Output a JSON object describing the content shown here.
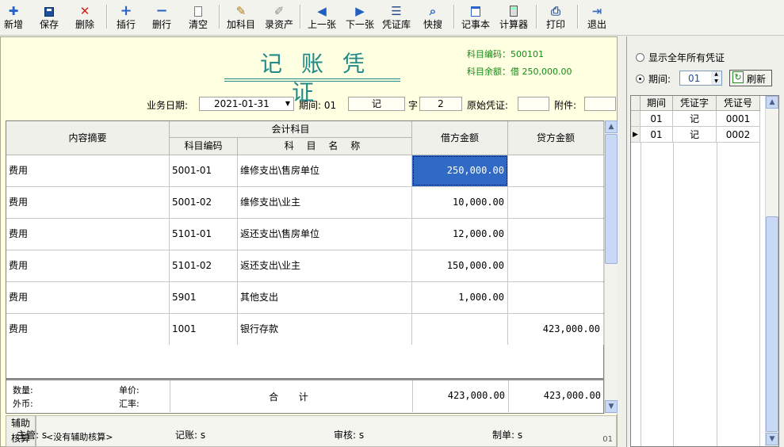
{
  "toolbar": {
    "items": [
      {
        "label": "新增",
        "icon": "add-icon"
      },
      {
        "label": "保存",
        "icon": "save-icon"
      },
      {
        "label": "删除",
        "icon": "delete-icon"
      },
      {
        "label": "插行",
        "icon": "insert-row-icon"
      },
      {
        "label": "删行",
        "icon": "delete-row-icon"
      },
      {
        "label": "清空",
        "icon": "clear-icon"
      },
      {
        "label": "加科目",
        "icon": "add-account-icon"
      },
      {
        "label": "录资产",
        "icon": "record-asset-icon"
      },
      {
        "label": "上一张",
        "icon": "arrow-left-icon"
      },
      {
        "label": "下一张",
        "icon": "arrow-right-icon"
      },
      {
        "label": "凭证库",
        "icon": "voucher-list-icon"
      },
      {
        "label": "快搜",
        "icon": "quick-search-icon"
      },
      {
        "label": "记事本",
        "icon": "notepad-icon"
      },
      {
        "label": "计算器",
        "icon": "calculator-icon"
      },
      {
        "label": "打印",
        "icon": "print-icon"
      },
      {
        "label": "退出",
        "icon": "exit-icon"
      }
    ]
  },
  "voucher": {
    "title": "记账凭证",
    "account_code_label": "科目编码：",
    "account_code": "500101",
    "account_balance_label": "科目余额：",
    "account_balance": "借 250,000.00",
    "business_date_label": "业务日期:",
    "business_date": "2021-01-31",
    "period_label": "期间:",
    "period": "01",
    "voucher_type": "记",
    "voucher_char_label": "字",
    "voucher_number": "2",
    "original_voucher_label": "原始凭证:",
    "original_voucher": "",
    "attachment_label": "附件:",
    "attachment": ""
  },
  "grid": {
    "headers": {
      "summary": "内容摘要",
      "account": "会计科目",
      "account_code": "科目编码",
      "account_name": "科 目 名 称",
      "debit": "借方金额",
      "credit": "贷方金额"
    },
    "rows": [
      {
        "summary": "费用",
        "code": "5001-01",
        "name": "维修支出\\售房单位",
        "debit": "250,000.00",
        "credit": ""
      },
      {
        "summary": "费用",
        "code": "5001-02",
        "name": "维修支出\\业主",
        "debit": "10,000.00",
        "credit": ""
      },
      {
        "summary": "费用",
        "code": "5101-01",
        "name": "返还支出\\售房单位",
        "debit": "12,000.00",
        "credit": ""
      },
      {
        "summary": "费用",
        "code": "5101-02",
        "name": "返还支出\\业主",
        "debit": "150,000.00",
        "credit": ""
      },
      {
        "summary": "费用",
        "code": "5901",
        "name": "其他支出",
        "debit": "1,000.00",
        "credit": ""
      },
      {
        "summary": "费用",
        "code": "1001",
        "name": "银行存款",
        "debit": "",
        "credit": "423,000.00"
      }
    ]
  },
  "totals": {
    "quantity_label": "数量:",
    "unit_price_label": "单价:",
    "foreign_currency_label": "外币:",
    "exchange_rate_label": "汇率:",
    "total_label": "合  计",
    "debit_total": "423,000.00",
    "credit_total": "423,000.00"
  },
  "auxiliary": {
    "label_line1": "辅助",
    "label_line2": "核算",
    "content": "<没有辅助核算>",
    "page": "01"
  },
  "footer": {
    "supervisor_label": "主管:",
    "supervisor": "s",
    "bookkeeper_label": "记账:",
    "bookkeeper": "s",
    "reviewer_label": "审核:",
    "reviewer": "s",
    "preparer_label": "制单:",
    "preparer": "s"
  },
  "right_panel": {
    "show_all_label": "显示全年所有凭证",
    "period_label": "期间:",
    "period_value": "01",
    "refresh_label": "刷新",
    "headers": [
      "期间",
      "凭证字",
      "凭证号"
    ],
    "rows": [
      {
        "period": "01",
        "type": "记",
        "number": "0001"
      },
      {
        "period": "01",
        "type": "记",
        "number": "0002"
      }
    ]
  },
  "colors": {
    "voucher_bg": "#ffffe1",
    "title": "#1f8a8a",
    "account_info": "#158a15",
    "selection": "#316ac5"
  }
}
